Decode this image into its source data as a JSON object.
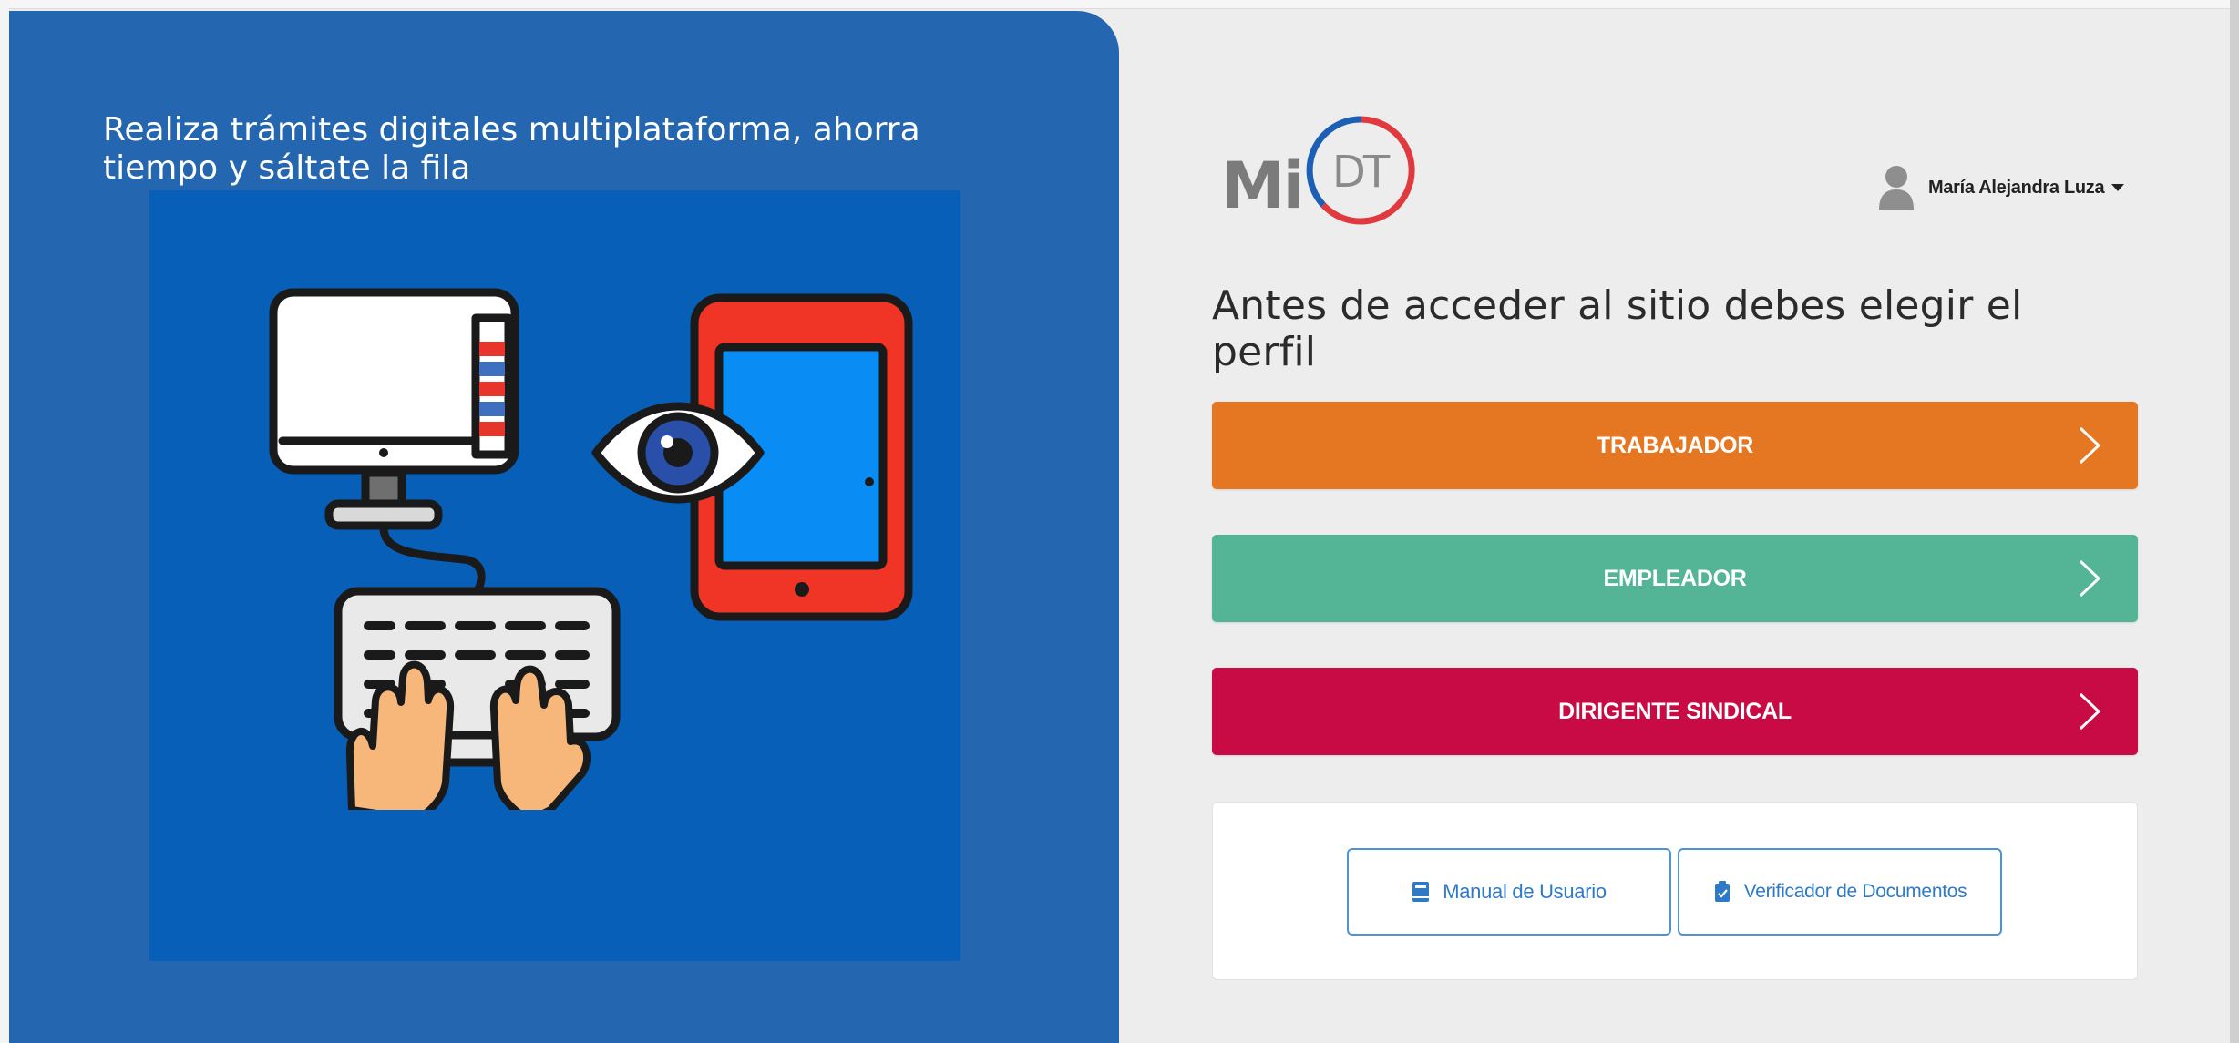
{
  "hero": {
    "tagline": "Realiza trámites digitales multiplataforma, ahorra tiempo y sáltate la fila"
  },
  "logo": {
    "prefix": "Mi",
    "mark": "DT"
  },
  "user_menu": {
    "name": "María Alejandra Luza",
    "icon": "user-icon"
  },
  "main": {
    "heading": "Antes de acceder al sitio debes elegir el perfil",
    "profiles": [
      {
        "label": "TRABAJADOR",
        "color": "#e67722"
      },
      {
        "label": "EMPLEADOR",
        "color": "#54b596"
      },
      {
        "label": "DIRIGENTE SINDICAL",
        "color": "#c80b44"
      }
    ]
  },
  "help": {
    "manual_label": "Manual de Usuario",
    "manual_icon": "book-icon",
    "verifier_label": "Verificador de Documentos",
    "verifier_icon": "clipboard-check-icon"
  },
  "colors": {
    "panel_blue": "#2566b0",
    "illustration_blue": "#075fb7",
    "link_blue": "#2f7ac7",
    "logo_red": "#e0393e",
    "logo_blue": "#1c5fb5"
  }
}
